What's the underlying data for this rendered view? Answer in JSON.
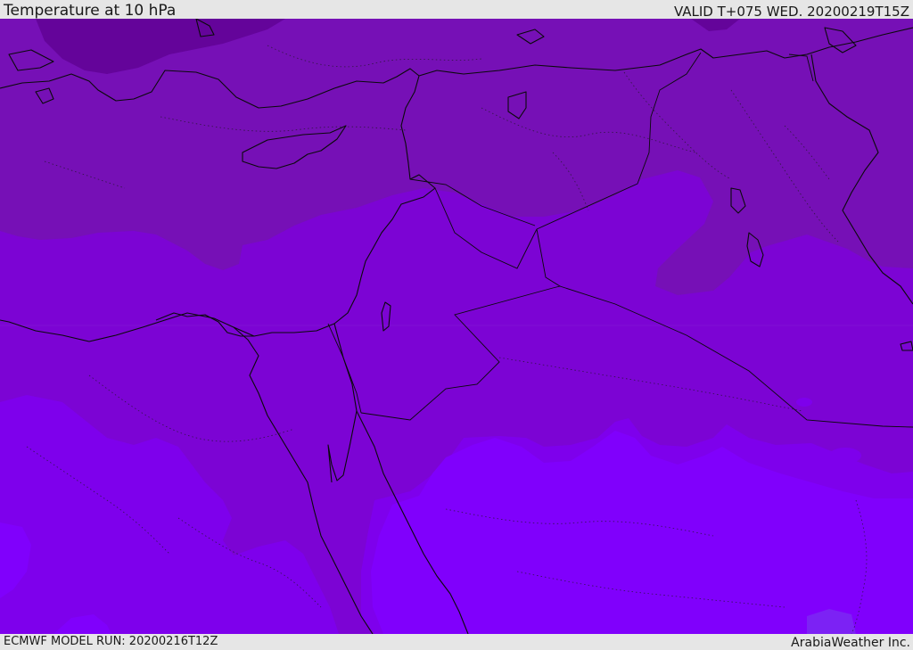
{
  "header": {
    "title": "Temperature at 10 hPa",
    "valid_time": "VALID T+075 WED. 20200219T15Z"
  },
  "footer": {
    "model_run": "ECMWF MODEL RUN: 20200216T12Z",
    "credit": "ArabiaWeather Inc."
  },
  "colors": {
    "band_coldest": "#64049a",
    "band_cold": "#7610b6",
    "band_mid": "#7c04d4",
    "band_warm": "#7e00ec",
    "band_warmest": "#8000fc",
    "patch_blue": "#7c22f4",
    "coastline": "#0a0a0a",
    "frame": "#e6e6e6"
  }
}
